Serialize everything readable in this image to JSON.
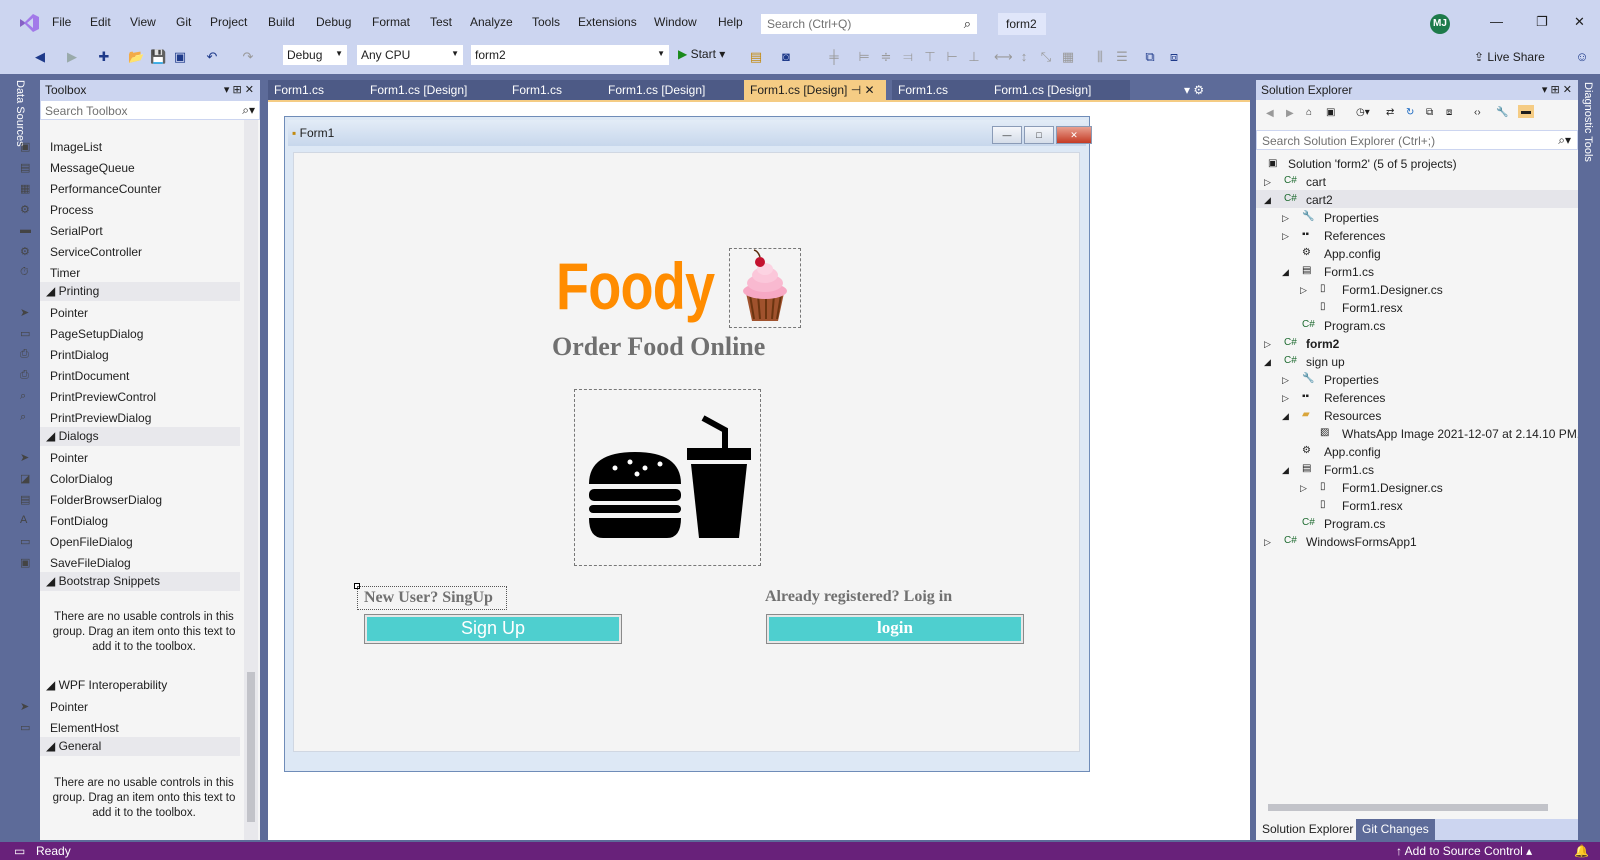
{
  "app": {
    "menu": [
      "File",
      "Edit",
      "View",
      "Git",
      "Project",
      "Build",
      "Debug",
      "Format",
      "Test",
      "Analyze",
      "Tools",
      "Extensions",
      "Window",
      "Help"
    ],
    "search_placeholder": "Search (Ctrl+Q)",
    "solution_badge": "form2",
    "avatar_initials": "MJ",
    "colors": {
      "accent": "#68217a",
      "tab_active": "#f5cc84",
      "chrome": "#ccd5f0",
      "frame": "#5d6b99"
    }
  },
  "toolbar": {
    "config": "Debug",
    "platform": "Any CPU",
    "startup": "form2",
    "start_label": "Start",
    "live_share": "Live Share"
  },
  "left_strip": {
    "label": "Data Sources"
  },
  "right_strip": {
    "label": "Diagnostic Tools"
  },
  "toolbox": {
    "title": "Toolbox",
    "search_placeholder": "Search Toolbox",
    "items_top": [
      "ImageList",
      "MessageQueue",
      "PerformanceCounter",
      "Process",
      "SerialPort",
      "ServiceController",
      "Timer"
    ],
    "groups": {
      "printing": {
        "label": "Printing",
        "items": [
          "Pointer",
          "PageSetupDialog",
          "PrintDialog",
          "PrintDocument",
          "PrintPreviewControl",
          "PrintPreviewDialog"
        ]
      },
      "dialogs": {
        "label": "Dialogs",
        "items": [
          "Pointer",
          "ColorDialog",
          "FolderBrowserDialog",
          "FontDialog",
          "OpenFileDialog",
          "SaveFileDialog"
        ]
      },
      "bootstrap": {
        "label": "Bootstrap Snippets",
        "note": "There are no usable controls in this group. Drag an item onto this text to add it to the toolbox."
      },
      "wpf": {
        "label": "WPF Interoperability",
        "items": [
          "Pointer",
          "ElementHost"
        ]
      },
      "general": {
        "label": "General",
        "note": "There are no usable controls in this group. Drag an item onto this text to add it to the toolbox."
      }
    }
  },
  "doc_tabs": [
    "Form1.cs",
    "Form1.cs [Design]",
    "Form1.cs",
    "Form1.cs [Design]",
    "Form1.cs [Design]",
    "Form1.cs",
    "Form1.cs [Design]"
  ],
  "form": {
    "title": "Form1",
    "brand": "Foody",
    "tagline": "Order Food Online",
    "new_user_label": "New User? SingUp",
    "signup_button": "Sign Up",
    "registered_label": "Already registered? Loig in",
    "login_button": "login"
  },
  "solution_explorer": {
    "title": "Solution Explorer",
    "search_placeholder": "Search Solution Explorer (Ctrl+;)",
    "nodes": [
      "Solution 'form2' (5 of 5 projects)",
      "cart",
      "cart2",
      "Properties",
      "References",
      "App.config",
      "Form1.cs",
      "Form1.Designer.cs",
      "Form1.resx",
      "Program.cs",
      "form2",
      "sign up",
      "Properties",
      "References",
      "Resources",
      "WhatsApp Image 2021-12-07 at 2.14.10 PM.jp",
      "App.config",
      "Form1.cs",
      "Form1.Designer.cs",
      "Form1.resx",
      "Program.cs",
      "WindowsFormsApp1"
    ],
    "tabs": [
      "Solution Explorer",
      "Git Changes"
    ]
  },
  "status": {
    "left": "Ready",
    "right": "Add to Source Control"
  }
}
